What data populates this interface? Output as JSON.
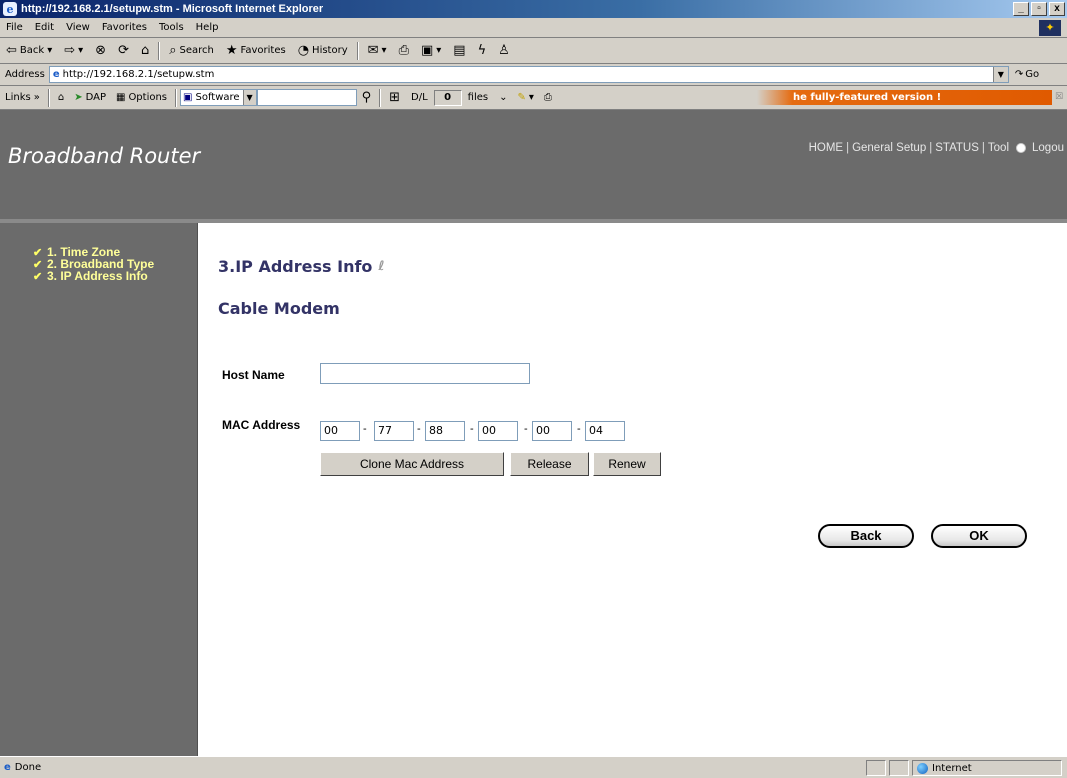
{
  "window": {
    "title": "http://192.168.2.1/setupw.stm - Microsoft Internet Explorer",
    "controls": [
      "_",
      "▫",
      "x"
    ]
  },
  "menu": [
    "File",
    "Edit",
    "View",
    "Favorites",
    "Tools",
    "Help"
  ],
  "toolbar": {
    "back": "Back",
    "search": "Search",
    "favorites": "Favorites",
    "history": "History"
  },
  "address": {
    "label": "Address",
    "url": "http://192.168.2.1/setupw.stm",
    "go": "Go"
  },
  "links_bar": {
    "links": "Links",
    "dap": "DAP",
    "options": "Options",
    "software": "Software",
    "dl": "D/L",
    "count": "0",
    "files": "files",
    "promo": "he fully-featured version !"
  },
  "router": {
    "brand": "Broadband Router",
    "nav": {
      "home": "HOME",
      "general": "General Setup",
      "status": "STATUS",
      "tool": "Tool",
      "logout": "Logou"
    },
    "sidebar": [
      {
        "label": "1. Time Zone"
      },
      {
        "label": "2. Broadband Type"
      },
      {
        "label": "3. IP Address Info"
      }
    ],
    "heading": "3.IP Address Info",
    "subheading": "Cable Modem",
    "host_label": "Host Name",
    "host_value": "",
    "mac_label": "MAC Address",
    "mac": [
      "00",
      "77",
      "88",
      "00",
      "00",
      "04"
    ],
    "clone_label": "Clone Mac Address",
    "release_label": "Release",
    "renew_label": "Renew",
    "back_label": "Back",
    "ok_label": "OK"
  },
  "status": {
    "text": "Done",
    "zone": "Internet"
  }
}
